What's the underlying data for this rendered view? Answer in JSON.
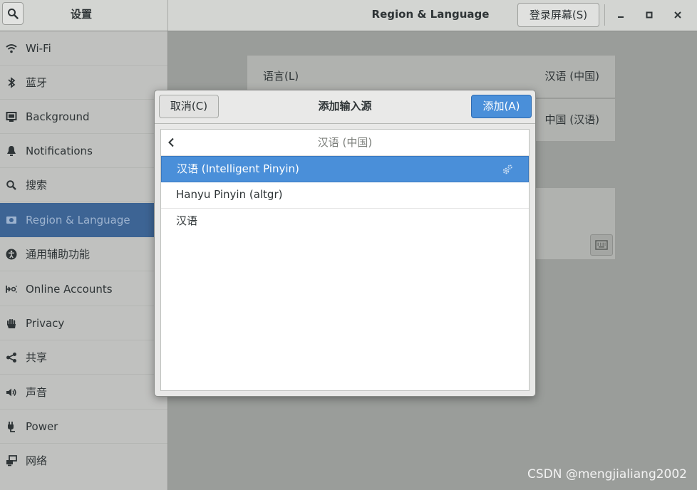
{
  "titlebar": {
    "left_title": "设置",
    "main_title": "Region & Language",
    "login_button": "登录屏幕(S)"
  },
  "sidebar": {
    "items": [
      {
        "label": "Wi-Fi",
        "icon": "wifi-icon"
      },
      {
        "label": "蓝牙",
        "icon": "bluetooth-icon"
      },
      {
        "label": "Background",
        "icon": "background-icon"
      },
      {
        "label": "Notifications",
        "icon": "bell-icon"
      },
      {
        "label": "搜索",
        "icon": "search-icon"
      },
      {
        "label": "Region & Language",
        "icon": "region-icon",
        "active": true
      },
      {
        "label": "通用辅助功能",
        "icon": "accessibility-icon"
      },
      {
        "label": "Online Accounts",
        "icon": "online-accounts-icon"
      },
      {
        "label": "Privacy",
        "icon": "hand-icon"
      },
      {
        "label": "共享",
        "icon": "share-icon"
      },
      {
        "label": "声音",
        "icon": "speaker-icon"
      },
      {
        "label": "Power",
        "icon": "power-icon"
      },
      {
        "label": "网络",
        "icon": "network-icon"
      }
    ]
  },
  "main": {
    "language_label": "语言(L)",
    "language_value": "汉语 (中国)",
    "formats_value": "中国 (汉语)"
  },
  "dialog": {
    "cancel": "取消(C)",
    "title": "添加输入源",
    "add": "添加(A)",
    "list_header": "汉语 (中国)",
    "rows": [
      {
        "label": "汉语 (Intelligent Pinyin)",
        "selected": true,
        "icon": "settings-gears-icon"
      },
      {
        "label": "Hanyu Pinyin (altgr)"
      },
      {
        "label": "汉语"
      }
    ]
  },
  "watermark": "CSDN @mengjialiang2002",
  "colors": {
    "accent": "#4a8fd9",
    "sidebar_active": "#3d6494"
  }
}
